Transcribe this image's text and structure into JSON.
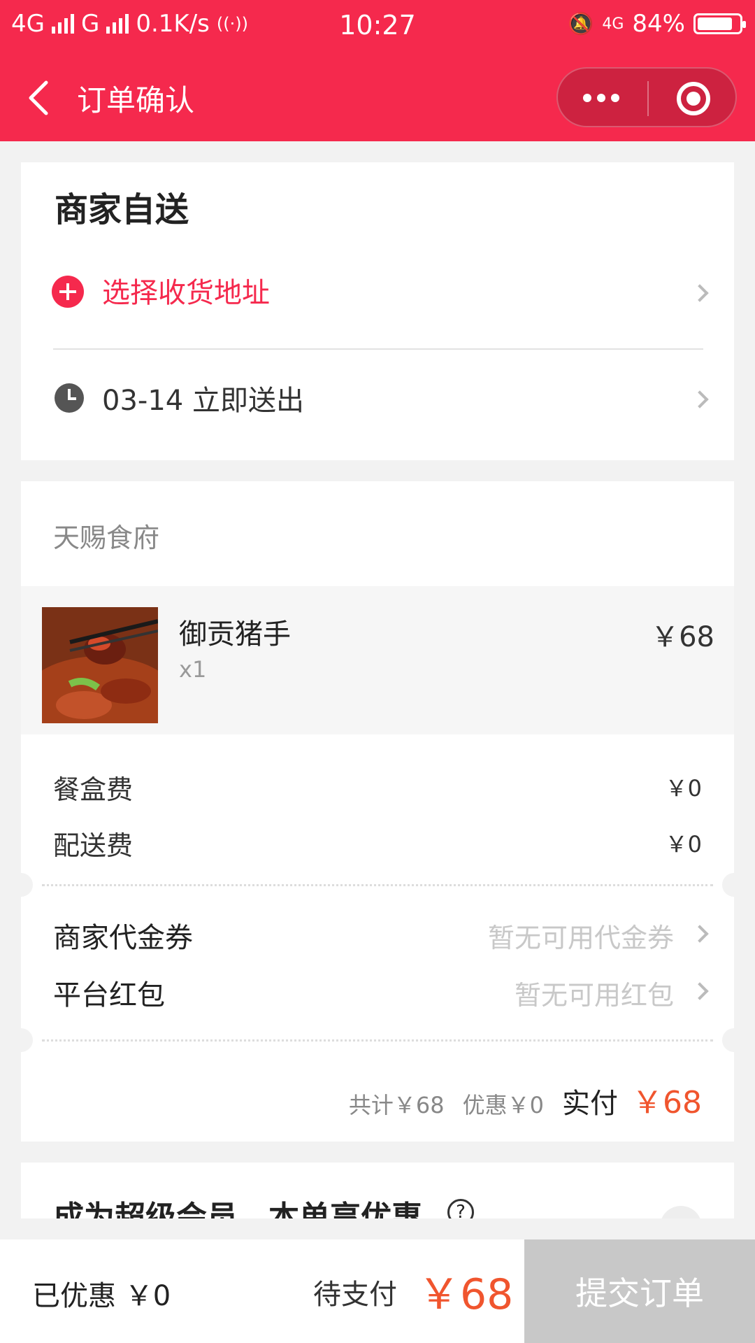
{
  "status_bar": {
    "network1": "4G",
    "network2": "G",
    "speed": "0.1K/s",
    "time": "10:27",
    "net_small": "4G",
    "battery": "84%",
    "battery_level": 0.84
  },
  "nav": {
    "title": "订单确认"
  },
  "delivery": {
    "heading": "商家自送",
    "address_prompt": "选择收货地址",
    "time": "03-14 立即送出"
  },
  "order": {
    "shop_name": "天赐食府",
    "items": [
      {
        "name": "御贡猪手",
        "qty": "x1",
        "price": "￥68"
      }
    ],
    "fees": [
      {
        "label": "餐盒费",
        "value": "￥0"
      },
      {
        "label": "配送费",
        "value": "￥0"
      }
    ],
    "coupons": [
      {
        "label": "商家代金券",
        "value": "暂无可用代金券"
      },
      {
        "label": "平台红包",
        "value": "暂无可用红包"
      }
    ],
    "summary": {
      "total": "共计￥68",
      "discount": "优惠￥0",
      "paid_label": "实付",
      "paid_value": "￥68"
    }
  },
  "vip": {
    "text": "成为超级会员，本单享优惠",
    "help": "?"
  },
  "bottom_bar": {
    "discount": "已优惠  ￥0",
    "to_pay_label": "待支付",
    "to_pay_value": "￥68",
    "submit": "提交订单"
  },
  "colors": {
    "brand": "#f5294d",
    "price": "#f0552e"
  }
}
